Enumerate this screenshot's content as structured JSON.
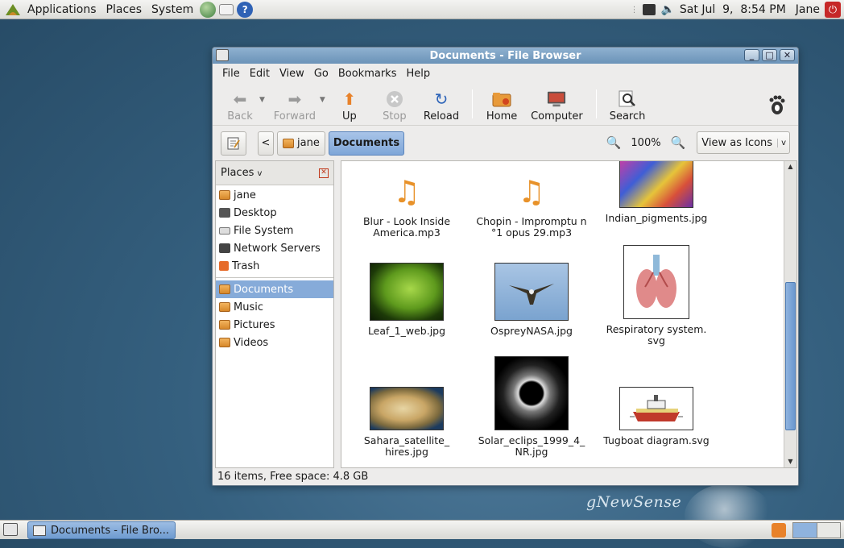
{
  "top_panel": {
    "menus": [
      "Applications",
      "Places",
      "System"
    ],
    "clock": "Sat Jul  9,  8:54 PM",
    "user": "Jane"
  },
  "window": {
    "title": "Documents - File Browser",
    "menubar": [
      "File",
      "Edit",
      "View",
      "Go",
      "Bookmarks",
      "Help"
    ],
    "toolbar": {
      "back": "Back",
      "forward": "Forward",
      "up": "Up",
      "stop": "Stop",
      "reload": "Reload",
      "home": "Home",
      "computer": "Computer",
      "search": "Search"
    },
    "location": {
      "back_arrow": "<",
      "crumb_home": "jane",
      "crumb_current": "Documents",
      "zoom": "100%",
      "view_mode": "View as Icons"
    },
    "sidebar": {
      "title": "Places",
      "items": [
        {
          "label": "jane",
          "icon": "home-folder-icon"
        },
        {
          "label": "Desktop",
          "icon": "desktop-icon"
        },
        {
          "label": "File System",
          "icon": "drive-icon"
        },
        {
          "label": "Network Servers",
          "icon": "network-icon"
        },
        {
          "label": "Trash",
          "icon": "trash-icon"
        }
      ],
      "bookmarks": [
        {
          "label": "Documents",
          "selected": true
        },
        {
          "label": "Music"
        },
        {
          "label": "Pictures"
        },
        {
          "label": "Videos"
        }
      ]
    },
    "files": [
      {
        "name": "Blur - Look Inside America.mp3",
        "line1": "Blur - Look Inside",
        "line2": "America.mp3",
        "type": "audio"
      },
      {
        "name": "Chopin - Impromptu n°1 opus 29.mp3",
        "line1": "Chopin - Impromptu n",
        "line2": "°1 opus 29.mp3",
        "type": "audio"
      },
      {
        "name": "Indian_pigments.jpg",
        "line1": "Indian_pigments.jpg",
        "line2": "",
        "type": "image"
      },
      {
        "name": "Leaf_1_web.jpg",
        "line1": "Leaf_1_web.jpg",
        "line2": "",
        "type": "image"
      },
      {
        "name": "OspreyNASA.jpg",
        "line1": "OspreyNASA.jpg",
        "line2": "",
        "type": "image"
      },
      {
        "name": "Respiratory system.svg",
        "line1": "Respiratory system.",
        "line2": "svg",
        "type": "image"
      },
      {
        "name": "Sahara_satellite_hires.jpg",
        "line1": "Sahara_satellite_",
        "line2": "hires.jpg",
        "type": "image"
      },
      {
        "name": "Solar_eclips_1999_4_NR.jpg",
        "line1": "Solar_eclips_1999_4_",
        "line2": "NR.jpg",
        "type": "image"
      },
      {
        "name": "Tugboat diagram.svg",
        "line1": "Tugboat diagram.svg",
        "line2": "",
        "type": "image"
      }
    ],
    "status": "16 items, Free space: 4.8 GB"
  },
  "desktop": {
    "brand": "gNewSense"
  },
  "bottom_panel": {
    "task": "Documents - File Bro..."
  },
  "colors": {
    "selection": "#86abd9",
    "titlebar": "#7aa0c4",
    "accent_orange": "#e8822a"
  }
}
